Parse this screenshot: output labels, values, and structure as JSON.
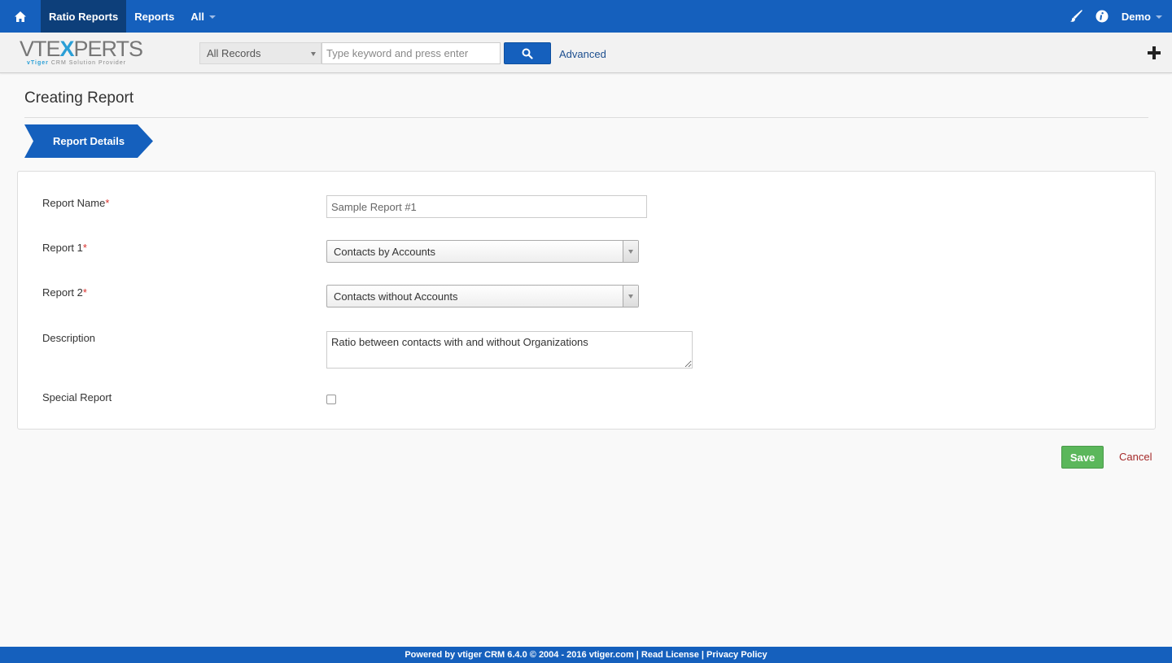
{
  "topnav": {
    "items": [
      {
        "label": "Ratio Reports"
      },
      {
        "label": "Reports"
      },
      {
        "label": "All"
      }
    ],
    "user": "Demo"
  },
  "logo": {
    "prefix": "VTE",
    "x": "X",
    "suffix": "PERTS",
    "sub_brand": "vTiger",
    "sub_rest": "CRM Solution Provider"
  },
  "search": {
    "scope": "All Records",
    "placeholder": "Type keyword and press enter",
    "advanced": "Advanced"
  },
  "page": {
    "title": "Creating Report",
    "step_label": "Report Details"
  },
  "form": {
    "report_name": {
      "label": "Report Name",
      "required": "*",
      "value": "Sample Report #1"
    },
    "report1": {
      "label": "Report 1",
      "required": "*",
      "value": "Contacts by Accounts"
    },
    "report2": {
      "label": "Report 2",
      "required": "*",
      "value": "Contacts without Accounts"
    },
    "description": {
      "label": "Description",
      "value": "Ratio between contacts with and without Organizations"
    },
    "special": {
      "label": "Special Report"
    }
  },
  "actions": {
    "save": "Save",
    "cancel": "Cancel"
  },
  "footer": {
    "text": "Powered by vtiger CRM 6.4.0  © 2004 - 2016  vtiger.com | Read License | Privacy Policy"
  },
  "colors": {
    "primary": "#1560bd",
    "active_nav": "#0d3f7a",
    "save": "#5bb75b",
    "cancel": "#a52a2a",
    "required": "#d9302c"
  }
}
